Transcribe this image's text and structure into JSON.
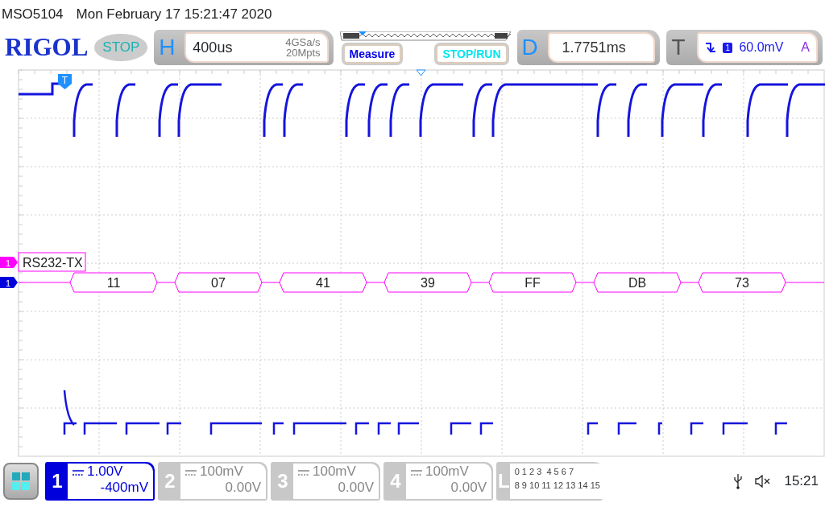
{
  "status_line": {
    "model": "MSO5104",
    "datetime": "Mon February 17 15:21:47 2020"
  },
  "logo": "RIGOL",
  "run_state": "STOP",
  "horizontal": {
    "letter": "H",
    "timebase": "400us",
    "sample_rate": "4GSa/s",
    "memory_depth": "20Mpts"
  },
  "measure_button": "Measure",
  "stop_run_button": "STOP/RUN",
  "delay": {
    "letter": "D",
    "value": "1.7751ms"
  },
  "trigger": {
    "letter": "T",
    "source": "1",
    "level": "60.0mV",
    "mode": "A"
  },
  "trigger_marker": "T",
  "decoder": {
    "marker": "1",
    "label": "RS232-TX",
    "packets": [
      "11",
      "07",
      "41",
      "39",
      "FF",
      "DB",
      "73"
    ]
  },
  "channel_marker": "1",
  "channels": [
    {
      "number": "1",
      "scale": "1.00V",
      "offset": "-400mV",
      "on": true
    },
    {
      "number": "2",
      "scale": "100mV",
      "offset": "0.00V",
      "on": false
    },
    {
      "number": "3",
      "scale": "100mV",
      "offset": "0.00V",
      "on": false
    },
    {
      "number": "4",
      "scale": "100mV",
      "offset": "0.00V",
      "on": false
    }
  ],
  "logic": {
    "letter": "L",
    "rows": [
      "0 1 2 3  4 5 6 7",
      "8 9 10 11 12 13 14 15"
    ]
  },
  "clock": "15:21"
}
